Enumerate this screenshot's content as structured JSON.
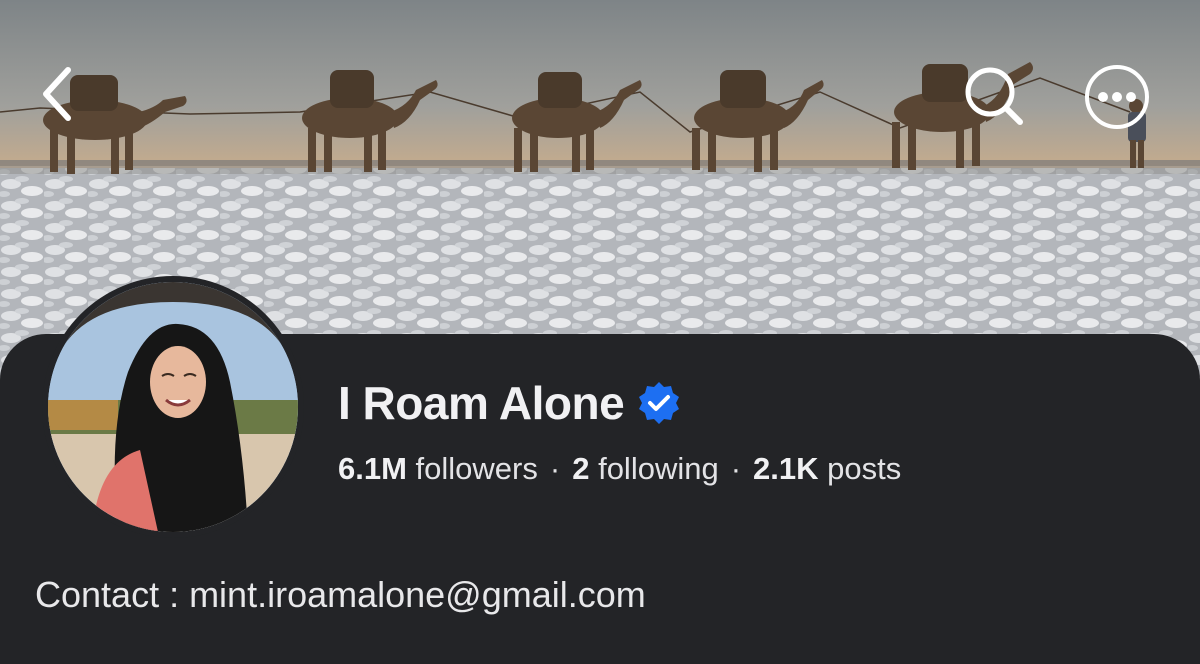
{
  "profile": {
    "name": "I Roam Alone",
    "verified": true,
    "stats": {
      "followers_value": "6.1M",
      "followers_label": "followers",
      "following_value": "2",
      "following_label": "following",
      "posts_value": "2.1K",
      "posts_label": "posts",
      "separator": "·"
    },
    "bio": "Contact : mint.iroamalone@gmail.com"
  },
  "nav": {
    "back_icon": "chevron-left-icon",
    "search_icon": "search-icon",
    "more_icon": "more-horizontal-icon"
  },
  "colors": {
    "background": "#232427",
    "verified_badge": "#1d6ff2",
    "text_primary": "#f1f1f3"
  }
}
